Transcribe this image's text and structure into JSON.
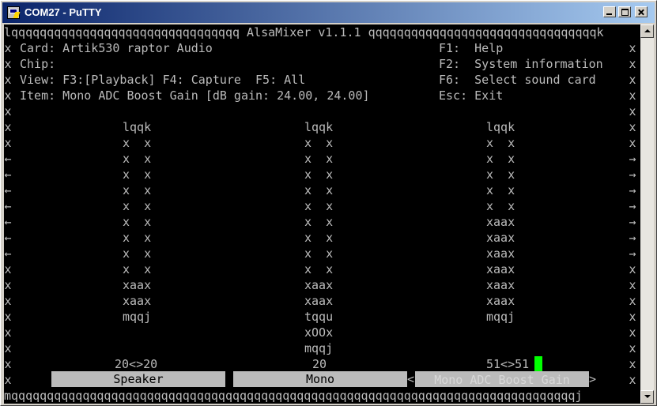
{
  "window": {
    "title": "COM27 - PuTTY"
  },
  "terminal": {
    "top_border": "lqqqqqqqqqqqqqqqqqqqqqqqqqqqqqqqq AlsaMixer v1.1.1 qqqqqqqqqqqqqqqqqqqqqqqqqqqqqqqqk",
    "bottom_border": "mqqqqqqqqqqqqqqqqqqqqqqqqqqqqqqqqqqqqqqqqqqqqqqqqqqqqqqqqqqqqqqqqqqqqqqqqqqqqqqqj",
    "card_line": "Card: Artik530 raptor Audio",
    "chip_line": "Chip:",
    "view_line": "View: F3:[Playback] F4: Capture  F5: All",
    "item_line": "Item: Mono ADC Boost Gain [dB gain: 24.00, 24.00]",
    "help": "F1:  Help",
    "sysinfo": "F2:  System information",
    "select_card": "F6:  Select sound card",
    "exit": "Esc: Exit",
    "border_char": "x",
    "arrow_left": "←",
    "arrow_right": "→",
    "left_arrows": [
      "x",
      "x",
      "←",
      "←",
      "←",
      "←",
      "←",
      "←",
      "←",
      "x",
      "x",
      "x",
      "x",
      "x",
      "x",
      "x"
    ],
    "right_arrows": [
      "x",
      "x",
      "→",
      "→",
      "→",
      "→",
      "→",
      "→",
      "→",
      "x",
      "x",
      "x",
      "x",
      "x",
      "x",
      "x"
    ]
  },
  "controls": [
    {
      "name": "Speaker",
      "value": "20<>20",
      "bar": [
        "lqqk",
        "x  x",
        "x  x",
        "x  x",
        "x  x",
        "x  x",
        "x  x",
        "x  x",
        "x  x",
        "x  x",
        "xaax",
        "xaax",
        "mqqj"
      ]
    },
    {
      "name": "Mono",
      "value": "20",
      "bar": [
        "lqqk",
        "x  x",
        "x  x",
        "x  x",
        "x  x",
        "x  x",
        "x  x",
        "x  x",
        "x  x",
        "x  x",
        "xaax",
        "xaax",
        "tqqu",
        "xOOx",
        "mqqj"
      ]
    },
    {
      "name": "Mono ADC Boost Gain",
      "value": "51<>51",
      "bar": [
        "lqqk",
        "x  x",
        "x  x",
        "x  x",
        "x  x",
        "x  x",
        "xaax",
        "xaax",
        "xaax",
        "xaax",
        "xaax",
        "xaax",
        "mqqj"
      ]
    }
  ],
  "nav": {
    "prev": "<",
    "next": ">"
  }
}
